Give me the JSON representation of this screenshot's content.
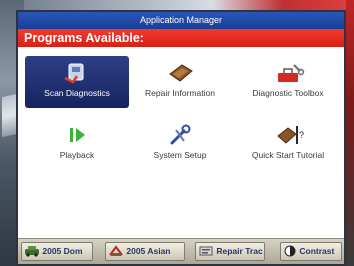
{
  "window": {
    "title": "Application Manager"
  },
  "header": {
    "programs_label": "Programs Available:"
  },
  "programs": [
    {
      "label": "Scan Diagnostics",
      "icon": "scan-diagnostics-icon",
      "selected": true
    },
    {
      "label": "Repair Information",
      "icon": "repair-information-icon",
      "selected": false
    },
    {
      "label": "Diagnostic Toolbox",
      "icon": "diagnostic-toolbox-icon",
      "selected": false
    },
    {
      "label": "Playback",
      "icon": "playback-icon",
      "selected": false
    },
    {
      "label": "System Setup",
      "icon": "system-setup-icon",
      "selected": false
    },
    {
      "label": "Quick Start Tutorial",
      "icon": "quick-start-tutorial-icon",
      "selected": false
    }
  ],
  "bottom_bar": {
    "buttons": [
      {
        "label": "2005 Dom",
        "icon": "car-domestic-icon"
      },
      {
        "label": "2005 Asian",
        "icon": "car-asian-icon"
      },
      {
        "label": "Repair Trac",
        "icon": "repair-trac-icon"
      },
      {
        "label": "Contrast",
        "icon": "contrast-icon"
      }
    ]
  },
  "colors": {
    "title_bar": "#173f97",
    "red_bar": "#d81f16",
    "selected_tile": "#16245e"
  }
}
